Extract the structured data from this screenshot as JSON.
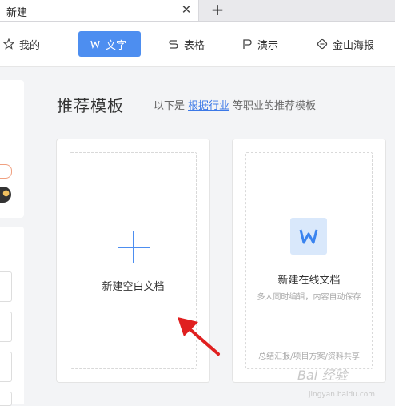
{
  "tabbar": {
    "tab_title": "新建",
    "close_symbol": "✕",
    "add_symbol": "+"
  },
  "nav": {
    "mine": "我的",
    "writer": "文字",
    "sheet": "表格",
    "presentation": "演示",
    "poster": "金山海报"
  },
  "main": {
    "heading": "推荐模板",
    "sub_prefix": "以下是",
    "sub_link": "根据行业",
    "sub_suffix": "等职业的推荐模板"
  },
  "cards": {
    "blank": {
      "label": "新建空白文档"
    },
    "online": {
      "label": "新建在线文档",
      "sub": "多人同时编辑，内容自动保存",
      "footer": "总结汇报/项目方案/资料共享",
      "icon": "writer-w-icon"
    }
  },
  "watermark": {
    "text": "Bai 经验",
    "sub": "jingyan.baidu.com"
  },
  "colors": {
    "accent": "#4d8ef0",
    "arrow": "#e02020"
  }
}
